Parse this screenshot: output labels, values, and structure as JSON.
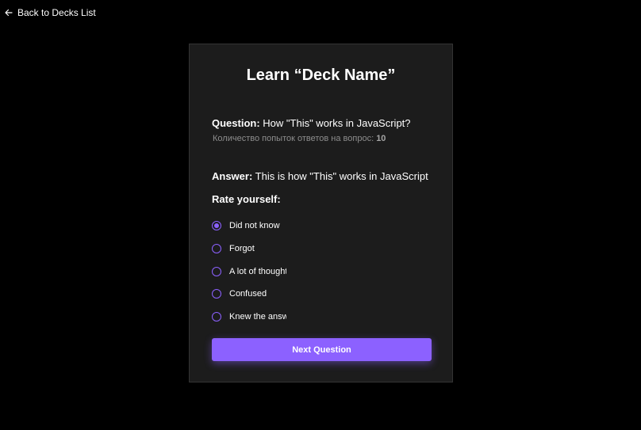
{
  "nav": {
    "back_label": "Back to Decks List",
    "back_icon": "arrow-left-icon"
  },
  "card": {
    "title": "Learn “Deck Name”",
    "question_label": "Question:",
    "question_text": " How \"This\" works in JavaScript?",
    "attempts_label": "Количество попыток ответов на вопрос: ",
    "attempts_count": "10",
    "answer_label": "Answer:",
    "answer_text": " This is how \"This\" works in JavaScript",
    "rate_label": "Rate yourself:",
    "options": [
      {
        "label": "Did not know",
        "checked": true
      },
      {
        "label": "Forgot",
        "checked": false
      },
      {
        "label": "A lot of thought",
        "checked": false
      },
      {
        "label": "Confused",
        "checked": false
      },
      {
        "label": "Knew the answer",
        "checked": false
      }
    ],
    "next_label": "Next Question"
  },
  "colors": {
    "accent": "#8c61ff",
    "background": "#000000",
    "card": "#1c1c1c"
  }
}
